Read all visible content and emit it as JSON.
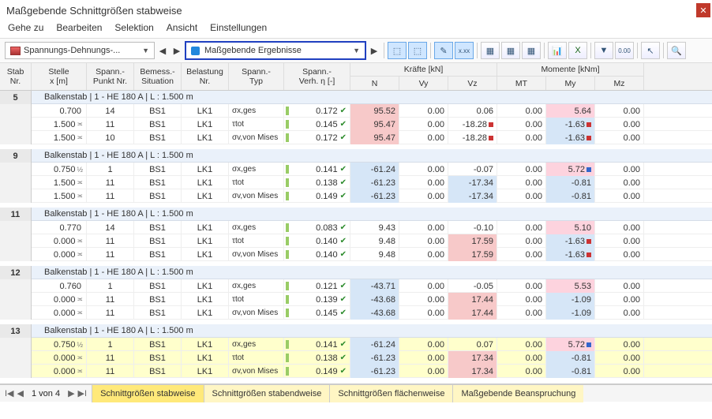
{
  "title": "Maßgebende Schnittgrößen stabweise",
  "menu": [
    "Gehe zu",
    "Bearbeiten",
    "Selektion",
    "Ansicht",
    "Einstellungen"
  ],
  "combo1": "Spannungs-Dehnungs-...",
  "combo2": "Maßgebende Ergebnisse",
  "headers": {
    "stab": "Stab\nNr.",
    "stelle": "Stelle\nx [m]",
    "spkt": "Spann.-\nPunkt Nr.",
    "bem": "Bemess.-\nSituation",
    "bel": "Belastung\nNr.",
    "typ": "Spann.-\nTyp",
    "verh": "Spann.-\nVerh. η [-]",
    "kraefte": "Kräfte [kN]",
    "momente": "Momente [kNm]",
    "n": "N",
    "vy": "Vy",
    "vz": "Vz",
    "mt": "MT",
    "my": "My",
    "mz": "Mz"
  },
  "group_label": "Balkenstab | 1 - HE 180 A | L : 1.500 m",
  "groups": [
    {
      "id": "5",
      "rows": [
        {
          "stelle": "0.700",
          "mrk": "",
          "spkt": "14",
          "bem": "BS1",
          "bel": "LK1",
          "typ": "σx,ges",
          "verh": "0.172",
          "n": "95.52",
          "nhl": "red",
          "vy": "0.00",
          "vz": "0.06",
          "mt": "0.00",
          "my": "5.64",
          "myhl": "pink",
          "mz": "0.00"
        },
        {
          "stelle": "1.500",
          "mrk": "≍",
          "spkt": "11",
          "bem": "BS1",
          "bel": "LK1",
          "typ": "τtot",
          "verh": "0.145",
          "n": "95.47",
          "nhl": "red",
          "vy": "0.00",
          "vz": "-18.28",
          "vzsq": "red",
          "mt": "0.00",
          "my": "-1.63",
          "mysq": "red",
          "myhl": "blue",
          "mz": "0.00"
        },
        {
          "stelle": "1.500",
          "mrk": "≍",
          "spkt": "10",
          "bem": "BS1",
          "bel": "LK1",
          "typ": "σv,von Mises",
          "verh": "0.172",
          "n": "95.47",
          "nhl": "red",
          "vy": "0.00",
          "vz": "-18.28",
          "vzsq": "red",
          "mt": "0.00",
          "my": "-1.63",
          "mysq": "red",
          "myhl": "blue",
          "mz": "0.00"
        }
      ]
    },
    {
      "id": "9",
      "rows": [
        {
          "stelle": "0.750",
          "mrk": "½",
          "spkt": "1",
          "bem": "BS1",
          "bel": "LK1",
          "typ": "σx,ges",
          "verh": "0.141",
          "n": "-61.24",
          "nhl": "blue",
          "vy": "0.00",
          "vz": "-0.07",
          "mt": "0.00",
          "my": "5.72",
          "mysq": "blue",
          "myhl": "pink",
          "mz": "0.00"
        },
        {
          "stelle": "1.500",
          "mrk": "≍",
          "spkt": "11",
          "bem": "BS1",
          "bel": "LK1",
          "typ": "τtot",
          "verh": "0.138",
          "n": "-61.23",
          "nhl": "blue",
          "vy": "0.00",
          "vz": "-17.34",
          "vzhl": "blue",
          "mt": "0.00",
          "my": "-0.81",
          "myhl": "blue",
          "mz": "0.00"
        },
        {
          "stelle": "1.500",
          "mrk": "≍",
          "spkt": "11",
          "bem": "BS1",
          "bel": "LK1",
          "typ": "σv,von Mises",
          "verh": "0.149",
          "n": "-61.23",
          "nhl": "blue",
          "vy": "0.00",
          "vz": "-17.34",
          "vzhl": "blue",
          "mt": "0.00",
          "my": "-0.81",
          "myhl": "blue",
          "mz": "0.00"
        }
      ]
    },
    {
      "id": "11",
      "rows": [
        {
          "stelle": "0.770",
          "mrk": "",
          "spkt": "14",
          "bem": "BS1",
          "bel": "LK1",
          "typ": "σx,ges",
          "verh": "0.083",
          "n": "9.43",
          "nhl": "",
          "vy": "0.00",
          "vz": "-0.10",
          "mt": "0.00",
          "my": "5.10",
          "myhl": "pink",
          "mz": "0.00"
        },
        {
          "stelle": "0.000",
          "mrk": "≍",
          "spkt": "11",
          "bem": "BS1",
          "bel": "LK1",
          "typ": "τtot",
          "verh": "0.140",
          "n": "9.48",
          "nhl": "",
          "vy": "0.00",
          "vz": "17.59",
          "vzhl": "red",
          "mt": "0.00",
          "my": "-1.63",
          "mysq": "red",
          "myhl": "blue",
          "mz": "0.00"
        },
        {
          "stelle": "0.000",
          "mrk": "≍",
          "spkt": "11",
          "bem": "BS1",
          "bel": "LK1",
          "typ": "σv,von Mises",
          "verh": "0.140",
          "n": "9.48",
          "nhl": "",
          "vy": "0.00",
          "vz": "17.59",
          "vzhl": "red",
          "mt": "0.00",
          "my": "-1.63",
          "mysq": "red",
          "myhl": "blue",
          "mz": "0.00"
        }
      ]
    },
    {
      "id": "12",
      "rows": [
        {
          "stelle": "0.760",
          "mrk": "",
          "spkt": "1",
          "bem": "BS1",
          "bel": "LK1",
          "typ": "σx,ges",
          "verh": "0.121",
          "n": "-43.71",
          "nhl": "blue",
          "vy": "0.00",
          "vz": "-0.05",
          "mt": "0.00",
          "my": "5.53",
          "myhl": "pink",
          "mz": "0.00"
        },
        {
          "stelle": "0.000",
          "mrk": "≍",
          "spkt": "11",
          "bem": "BS1",
          "bel": "LK1",
          "typ": "τtot",
          "verh": "0.139",
          "n": "-43.68",
          "nhl": "blue",
          "vy": "0.00",
          "vz": "17.44",
          "vzhl": "red",
          "mt": "0.00",
          "my": "-1.09",
          "myhl": "blue",
          "mz": "0.00"
        },
        {
          "stelle": "0.000",
          "mrk": "≍",
          "spkt": "11",
          "bem": "BS1",
          "bel": "LK1",
          "typ": "σv,von Mises",
          "verh": "0.145",
          "n": "-43.68",
          "nhl": "blue",
          "vy": "0.00",
          "vz": "17.44",
          "vzhl": "red",
          "mt": "0.00",
          "my": "-1.09",
          "myhl": "blue",
          "mz": "0.00"
        }
      ]
    },
    {
      "id": "13",
      "sel": true,
      "rows": [
        {
          "stelle": "0.750",
          "mrk": "½",
          "spkt": "1",
          "bem": "BS1",
          "bel": "LK1",
          "typ": "σx,ges",
          "verh": "0.141",
          "n": "-61.24",
          "nhl": "blue",
          "vy": "0.00",
          "vz": "0.07",
          "mt": "0.00",
          "my": "5.72",
          "mysq": "blue",
          "myhl": "pink",
          "mz": "0.00"
        },
        {
          "stelle": "0.000",
          "mrk": "≍",
          "spkt": "11",
          "bem": "BS1",
          "bel": "LK1",
          "typ": "τtot",
          "verh": "0.138",
          "n": "-61.23",
          "nhl": "blue",
          "vy": "0.00",
          "vz": "17.34",
          "vzhl": "red",
          "mt": "0.00",
          "my": "-0.81",
          "myhl": "blue",
          "mz": "0.00"
        },
        {
          "stelle": "0.000",
          "mrk": "≍",
          "spkt": "11",
          "bem": "BS1",
          "bel": "LK1",
          "typ": "σv,von Mises",
          "verh": "0.149",
          "n": "-61.23",
          "nhl": "blue",
          "vy": "0.00",
          "vz": "17.34",
          "vzhl": "red",
          "mt": "0.00",
          "my": "-0.81",
          "myhl": "blue",
          "mz": "0.00"
        }
      ]
    }
  ],
  "footer": {
    "pager": "1 von 4",
    "tabs": [
      "Schnittgrößen stabweise",
      "Schnittgrößen stabendweise",
      "Schnittgrößen flächenweise",
      "Maßgebende Beanspruchung"
    ]
  }
}
